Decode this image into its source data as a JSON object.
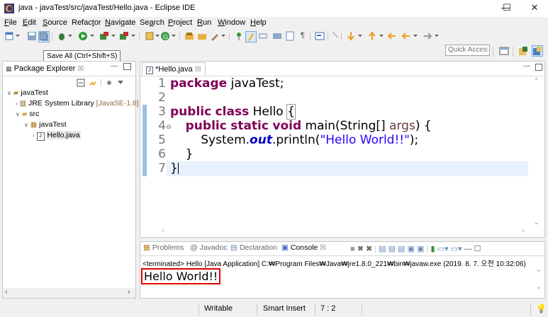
{
  "window": {
    "title": "java - javaTest/src/javaTest/Hello.java - Eclipse IDE",
    "minimize_glyph": "—",
    "maximize_glyph": "☐",
    "close_glyph": "✕"
  },
  "menu": [
    {
      "key": "F",
      "rest": "ile"
    },
    {
      "key": "E",
      "rest": "dit"
    },
    {
      "key": "S",
      "rest": "ource"
    },
    {
      "pre": "Refac",
      "key": "t",
      "rest": "or"
    },
    {
      "key": "N",
      "rest": "avigate"
    },
    {
      "pre": "Se",
      "key": "a",
      "rest": "rch"
    },
    {
      "key": "P",
      "rest": "roject"
    },
    {
      "key": "R",
      "rest": "un"
    },
    {
      "key": "W",
      "rest": "indow"
    },
    {
      "key": "H",
      "rest": "elp"
    }
  ],
  "tooltip": "Save All (Ctrl+Shift+S)",
  "quick_access": {
    "placeholder": "Quick Access"
  },
  "package_explorer": {
    "tab_label": "Package Explorer",
    "close_glyph": "☒",
    "tree": {
      "project": "javaTest",
      "jre_label": "JRE System Library",
      "jre_version": "[JavaSE-1.8]",
      "src": "src",
      "package": "javaTest",
      "file": "Hello.java"
    }
  },
  "editor": {
    "tab_label": "*Hello.java",
    "close_glyph": "☒",
    "line_numbers": [
      "1",
      "2",
      "3",
      "4",
      "5",
      "6",
      "7"
    ],
    "code": {
      "l1_kw": "package",
      "l1_rest": " javaTest;",
      "l3_kw1": "public",
      "l3_kw2": "class",
      "l3_name": " Hello ",
      "l3_brace": "{",
      "l4_kw1": "public",
      "l4_kw2": "static",
      "l4_kw3": "void",
      "l4_rest": " main(String[] ",
      "l4_args": "args",
      "l4_end": ") {",
      "l5_pre": "System.",
      "l5_out": "out",
      "l5_mid": ".println(",
      "l5_str": "\"Hello World!!\"",
      "l5_end": ");",
      "l6": "}",
      "l7": "}"
    }
  },
  "console": {
    "tabs": [
      "Problems",
      "Javadoc",
      "Declaration",
      "Console"
    ],
    "active_tab": "Console",
    "close_glyph": "☒",
    "terminated_line": "<terminated> Hello [Java Application] C:₩Program Files₩Java₩jre1.8.0_221₩bin₩javaw.exe (2019. 8. 7. 오전 10:32:06)",
    "output": "Hello World!!"
  },
  "status": {
    "writable": "Writable",
    "insert_mode": "Smart Insert",
    "position": "7 : 2"
  },
  "colors": {
    "keyword": "#7f0055",
    "string": "#2a00ff",
    "field": "#0000c0",
    "highlight_box": "#e00000",
    "current_line": "#e8f2fe"
  }
}
